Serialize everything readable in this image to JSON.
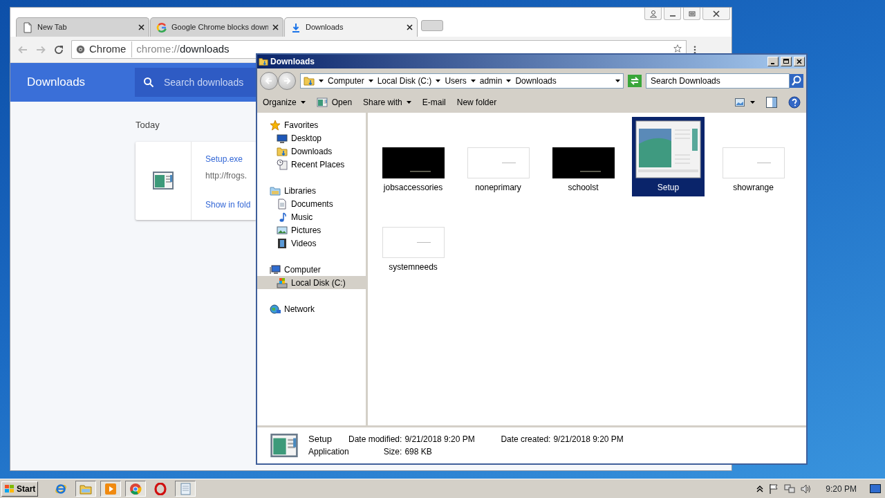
{
  "browser": {
    "tabs": [
      {
        "title": "New Tab",
        "kind": "page",
        "selected": false
      },
      {
        "title": "Google Chrome blocks down",
        "kind": "google",
        "selected": false
      },
      {
        "title": "Downloads",
        "kind": "download",
        "selected": true
      }
    ],
    "omnibox": {
      "chip": "Chrome",
      "scheme": "chrome://",
      "path": "downloads"
    },
    "page": {
      "title": "Downloads",
      "search": {
        "placeholder": "Search downloads"
      },
      "section": "Today",
      "download": {
        "file": "Setup.exe",
        "url": "http://frogs.",
        "action": "Show in fold"
      }
    }
  },
  "explorer": {
    "title": "Downloads",
    "breadcrumb": [
      "Computer",
      "Local Disk (C:)",
      "Users",
      "admin",
      "Downloads"
    ],
    "search": {
      "placeholder": "Search Downloads"
    },
    "toolbar": [
      {
        "label": "Organize",
        "kind": "plain",
        "dropdown": true
      },
      {
        "label": "Open",
        "kind": "iconic",
        "dropdown": false
      },
      {
        "label": "Share with",
        "kind": "plain",
        "dropdown": true
      },
      {
        "label": "E-mail",
        "kind": "plain",
        "dropdown": false
      },
      {
        "label": "New folder",
        "kind": "plain",
        "dropdown": false
      }
    ],
    "nav": [
      {
        "label": "Favorites",
        "kind": "star",
        "selected": false,
        "children": [
          {
            "label": "Desktop",
            "kind": "desktop",
            "selected": false
          },
          {
            "label": "Downloads",
            "kind": "folderdown",
            "selected": false
          },
          {
            "label": "Recent Places",
            "kind": "recent",
            "selected": false
          }
        ]
      },
      {
        "label": "Libraries",
        "kind": "libraries",
        "selected": false,
        "children": [
          {
            "label": "Documents",
            "kind": "documents",
            "selected": false
          },
          {
            "label": "Music",
            "kind": "music",
            "selected": false
          },
          {
            "label": "Pictures",
            "kind": "pictures",
            "selected": false
          },
          {
            "label": "Videos",
            "kind": "videos",
            "selected": false
          }
        ]
      },
      {
        "label": "Computer",
        "kind": "computer",
        "selected": false,
        "children": [
          {
            "label": "Local Disk (C:)",
            "kind": "disk",
            "selected": true
          }
        ]
      },
      {
        "label": "Network",
        "kind": "network",
        "selected": false
      }
    ],
    "files": [
      {
        "name": "jobsaccessories",
        "kind": "dark",
        "selected": false
      },
      {
        "name": "noneprimary",
        "kind": "light",
        "selected": false
      },
      {
        "name": "schoolst",
        "kind": "dark",
        "selected": false
      },
      {
        "name": "Setup",
        "kind": "app",
        "selected": true
      },
      {
        "name": "showrange",
        "kind": "light",
        "selected": false
      },
      {
        "name": "systemneeds",
        "kind": "light",
        "selected": false
      }
    ],
    "details": {
      "name": "Setup",
      "type": "Application",
      "fields": [
        {
          "label": "Date modified:",
          "value": "9/21/2018 9:20 PM"
        },
        {
          "label": "Size:",
          "value": "698 KB"
        },
        {
          "label": "Date created:",
          "value": "9/21/2018 9:20 PM"
        }
      ]
    }
  },
  "taskbar": {
    "start": "Start",
    "apps": [
      {
        "kind": "ie",
        "running": false
      },
      {
        "kind": "explorer",
        "running": true
      },
      {
        "kind": "media",
        "running": true
      },
      {
        "kind": "chrome",
        "running": true
      },
      {
        "kind": "opera",
        "running": false
      },
      {
        "kind": "notepad",
        "running": true
      }
    ],
    "clock": "9:20 PM"
  }
}
